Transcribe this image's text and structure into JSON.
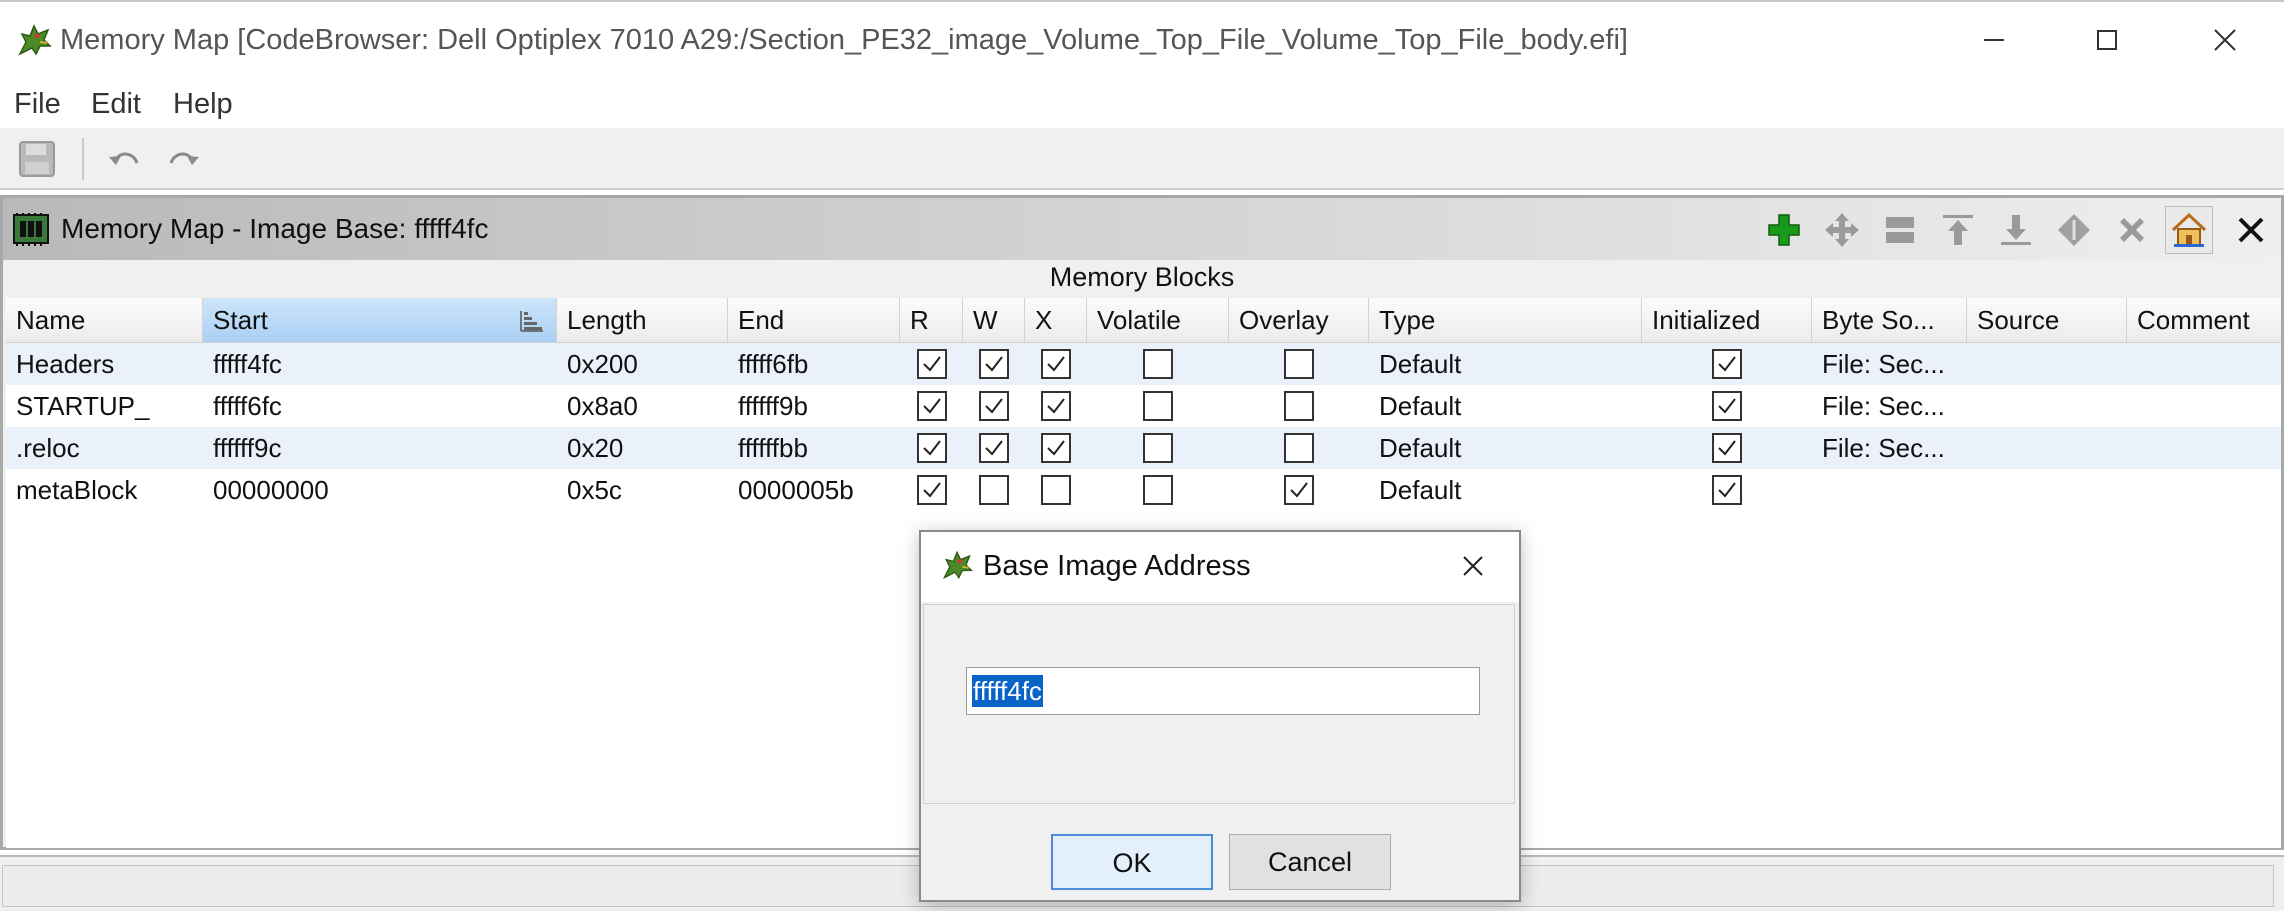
{
  "window": {
    "title": "Memory Map [CodeBrowser: Dell Optiplex 7010 A29:/Section_PE32_image_Volume_Top_File_Volume_Top_File_body.efi]",
    "app_icon": "ghidra-dragon-icon",
    "controls": [
      "minimize-icon",
      "maximize-icon",
      "close-icon"
    ]
  },
  "menu": {
    "file": "File",
    "edit": "Edit",
    "help": "Help"
  },
  "toolbar": {
    "icons": [
      "save-icon",
      "undo-icon",
      "redo-icon"
    ]
  },
  "panel": {
    "title": "Memory Map - Image Base: fffff4fc",
    "icon": "memory-chip-icon",
    "actions": [
      "add-block-icon",
      "move-block-icon",
      "split-block-icon",
      "expand-up-icon",
      "expand-down-icon",
      "merge-blocks-icon",
      "delete-block-icon",
      "set-image-base-icon",
      "close-icon"
    ],
    "section_label": "Memory Blocks"
  },
  "table": {
    "columns": [
      "Name",
      "Start",
      "Length",
      "End",
      "R",
      "W",
      "X",
      "Volatile",
      "Overlay",
      "Type",
      "Initialized",
      "Byte So...",
      "Source",
      "Comment"
    ],
    "sorted_column": "Start",
    "rows": [
      {
        "name": "Headers",
        "start": "fffff4fc",
        "length": "0x200",
        "end": "fffff6fb",
        "r": true,
        "w": true,
        "x": true,
        "volatile": false,
        "overlay": false,
        "type": "Default",
        "initialized": true,
        "byte_source": "File: Sec...",
        "source": "",
        "comment": ""
      },
      {
        "name": "STARTUP_",
        "start": "fffff6fc",
        "length": "0x8a0",
        "end": "ffffff9b",
        "r": true,
        "w": true,
        "x": true,
        "volatile": false,
        "overlay": false,
        "type": "Default",
        "initialized": true,
        "byte_source": "File: Sec...",
        "source": "",
        "comment": ""
      },
      {
        "name": ".reloc",
        "start": "ffffff9c",
        "length": "0x20",
        "end": "ffffffbb",
        "r": true,
        "w": true,
        "x": true,
        "volatile": false,
        "overlay": false,
        "type": "Default",
        "initialized": true,
        "byte_source": "File: Sec...",
        "source": "",
        "comment": ""
      },
      {
        "name": "metaBlock",
        "start": "00000000",
        "length": "0x5c",
        "end": "0000005b",
        "r": true,
        "w": false,
        "x": false,
        "volatile": false,
        "overlay": true,
        "type": "Default",
        "initialized": true,
        "byte_source": "",
        "source": "",
        "comment": ""
      }
    ]
  },
  "dialog": {
    "title": "Base Image Address",
    "input_value": "fffff4fc",
    "ok_label": "OK",
    "cancel_label": "Cancel"
  },
  "colors": {
    "selection": "#0a64c8",
    "sorted_header": "#a9d0f5",
    "alt_row": "#eaf1fb",
    "add_icon": "#1a9a1a"
  }
}
